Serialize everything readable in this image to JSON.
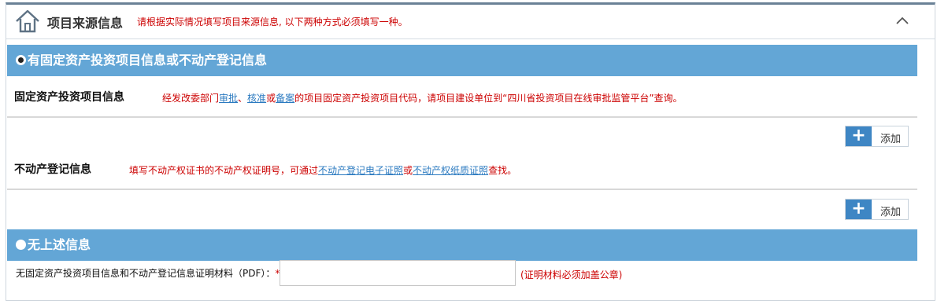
{
  "header": {
    "title": "项目来源信息",
    "note": "请根据实际情况填写项目来源信息, 以下两种方式必须填写一种。"
  },
  "option1": {
    "label": "有固定资产投资项目信息或不动产登记信息",
    "selected": true
  },
  "fixed_asset": {
    "label": "固定资产投资项目信息",
    "note_prefix": "经发改委部门",
    "link_approve": "审批",
    "sep1": "、",
    "link_verify": "核准",
    "sep2": "或",
    "link_record": "备案",
    "note_suffix": "的项目固定资产投资项目代码，请项目建设单位到“四川省投资项目在线审批监管平台”查询。",
    "add_label": "添加"
  },
  "real_estate": {
    "label": "不动产登记信息",
    "note_prefix": "填写不动产权证书的不动产权证明号，可通过",
    "link_electronic": "不动产登记电子证照",
    "sep": "或",
    "link_paper": "不动产权纸质证照",
    "note_suffix": "查找。",
    "add_label": "添加"
  },
  "option2": {
    "label": "无上述信息",
    "selected": false
  },
  "pdf": {
    "label": "无固定资产投资项目信息和不动产登记信息证明材料（PDF）：",
    "required_mark": "*",
    "value": "",
    "note": "(证明材料必须加盖公章)"
  },
  "colors": {
    "bar": "#63a6d6",
    "add_button": "#3e86c4",
    "note_red": "#cc0000",
    "link": "#2b7ac0"
  }
}
